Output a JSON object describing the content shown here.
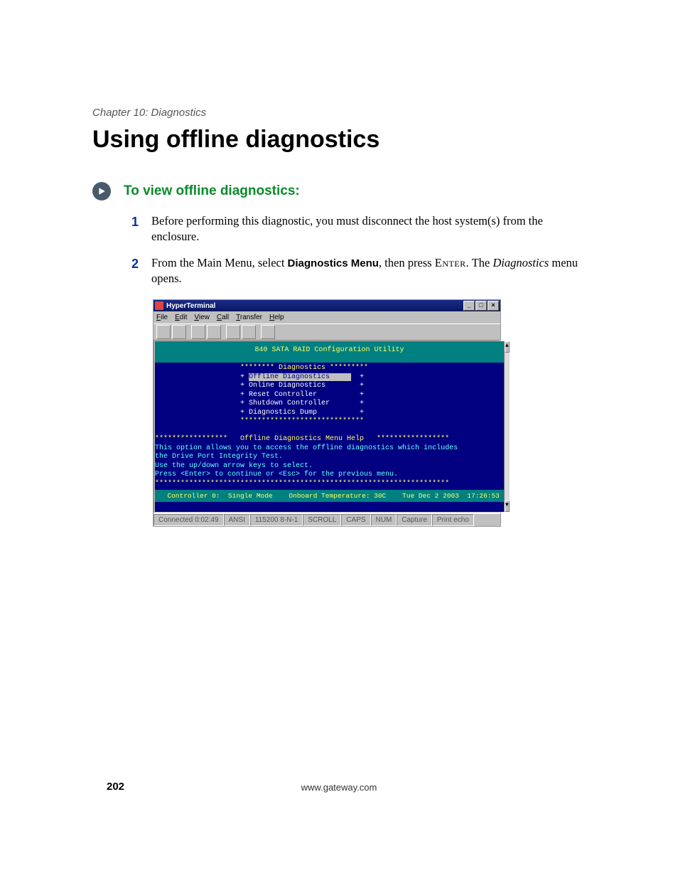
{
  "chapter": "Chapter 10: Diagnostics",
  "title": "Using offline diagnostics",
  "procedure_title": "To view offline diagnostics:",
  "steps": {
    "s1": {
      "num": "1",
      "text": "Before performing this diagnostic, you must disconnect the host system(s) from the enclosure."
    },
    "s2": {
      "num": "2",
      "pre": "From the Main Menu, select ",
      "bold": "Diagnostics Menu",
      "mid": ", then press ",
      "sc": "Enter",
      "post1": ". The ",
      "ital": "Diagnostics",
      "post2": " menu opens."
    }
  },
  "ht": {
    "title": "HyperTerminal",
    "menubar": [
      "File",
      "Edit",
      "View",
      "Call",
      "Transfer",
      "Help"
    ],
    "status": {
      "connected": "Connected 0:02:49",
      "emulation": "ANSI",
      "config": "115200 8-N-1",
      "scroll": "SCROLL",
      "caps": "CAPS",
      "num": "NUM",
      "capture": "Capture",
      "echo": "Print echo"
    }
  },
  "terminal": {
    "header": "840 SATA RAID Configuration Utility",
    "box_top": "                    ******** Diagnostics *********",
    "items": {
      "offline": "                    + Offline Diagnostics       +",
      "online": "                    + Online Diagnostics        +",
      "reset": "                    + Reset Controller          +",
      "shutdown": "                    + Shutdown Controller       +",
      "dump": "                    + Diagnostics Dump          +"
    },
    "box_bot": "                    *****************************",
    "help_hdr": "*****************   Offline Diagnostics Menu Help   *****************",
    "help1": "This option allows you to access the offline diagnostics which includes",
    "help2": "the Drive Port Integrity Test.",
    "help3": "Use the up/down arrow keys to select.",
    "help4": "Press <Enter> to continue or <Esc> for the previous menu.",
    "help_bot": "*********************************************************************",
    "statusline": "  Controller 0:  Single Mode    Onboard Temperature: 30C    Tue Dec 2 2003  17:26:53"
  },
  "footer": {
    "url": "www.gateway.com",
    "page": "202"
  }
}
